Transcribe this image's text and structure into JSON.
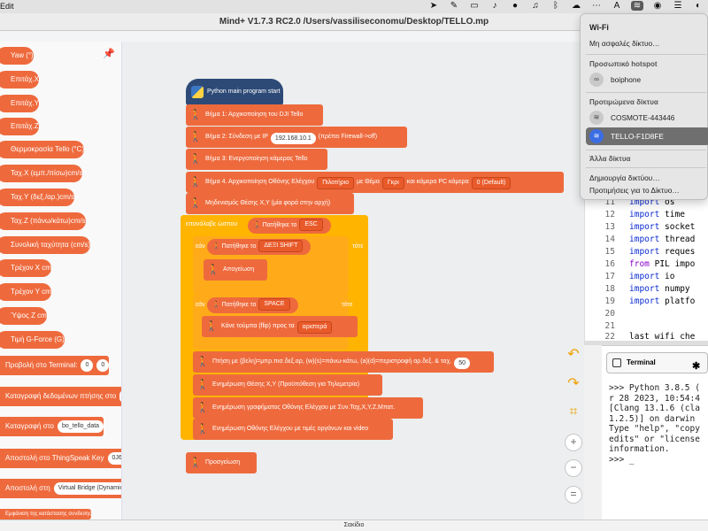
{
  "menubar": {
    "left_text": "Edit",
    "icons": [
      "location-icon",
      "pen-icon",
      "battery-icon",
      "volume-icon",
      "mic-icon",
      "music-icon",
      "bluetooth-icon",
      "bluetooth-alt-icon",
      "cloud-icon",
      "dots-icon",
      "text-input-icon",
      "wifi-icon",
      "user-icon",
      "settings-icon",
      "switch-icon",
      "siri-icon"
    ]
  },
  "window": {
    "title": "Mind+ V1.7.3 RC2.0  /Users/vassiliseconomu/Desktop/TELLO.mp"
  },
  "palette": {
    "blocks": [
      {
        "label": "Yaw (°)"
      },
      {
        "label": "Επιτάχ.X"
      },
      {
        "label": "Επιτάχ.Y"
      },
      {
        "label": "Επιτάχ.Z"
      },
      {
        "label": "Θερμοκρασία Tello (°C)"
      },
      {
        "label": "Ταχ.X (εμπ./πίσω)cm/s"
      },
      {
        "label": "Ταχ.Y (δεξ./αρ.)cm/s"
      },
      {
        "label": "Ταχ.Z (πάνω/κάτω)cm/s"
      },
      {
        "label": "Συνολική ταχύτητα (cm/s)"
      },
      {
        "label": "Τρέχον X cm"
      },
      {
        "label": "Τρέχον Y cm"
      },
      {
        "label": "Ύψος Z cm"
      },
      {
        "label": "Τιμή G-Force (G)"
      }
    ],
    "commands": [
      {
        "label": "Προβολή στο Terminal:",
        "inputs": [
          "0",
          "0"
        ]
      },
      {
        "label": "Καταγραφή δεδομένων πτήσης στο",
        "inputs": [
          ""
        ]
      },
      {
        "label": "Καταγραφή στο",
        "inputs": [
          "bo_tello_data"
        ]
      },
      {
        "label": "Αποστολή στο ThingSpeak Key",
        "inputs": [
          "0J62F"
        ]
      },
      {
        "label": "Αποστολή στη",
        "inputs": [
          "Virtual Bridge (Dynamic"
        ]
      },
      {
        "label": "Εμφάνιση της κατάστασης συνδεσης"
      }
    ]
  },
  "workspace": {
    "hat_label": "Python main program start",
    "steps": [
      "Βήμα 1: Αρχικοποίηση του DJI Tello",
      "Βήμα 2: Σύνδεση με IP",
      "Βήμα 3: Ενεργοποίηση κάμερας Tello",
      "Βήμα 4. Αρχικοποίηση Οθόνης Ελέγχου",
      "Μηδενισμός Θέσης X,Y (μία φορά στην αρχή)"
    ],
    "ip_value": "192.168.10.1",
    "ip_note": "(πρέπει Firewall->off)",
    "step4_mode": "Πιλοτήριο",
    "step4_theme_label": "με Θέμα",
    "step4_theme": "Γκρι",
    "step4_camera_label": "και κάμερα PC  κάμερα",
    "step4_camera": "0 (Default)",
    "loop_label": "επανάλαβε ώσπου",
    "pressed_label": "Πατήθηκε το",
    "key_esc": "ESC",
    "if_label": "εάν",
    "then_label": "τότε",
    "key_shift": "ΔΕΞΙ SHIFT",
    "land_label": "Απογείωση",
    "key_space": "SPACE",
    "flip_label": "Κάνε τούμπα (flip) προς τα",
    "flip_dir": "αριστερά",
    "fly_label": "Πτήση με (βελη)=μπρ.πισ.δεξ.αρ, (w)(s)=πάνω-κάτω, (a)(d)=περιστροφή αρ.δεξ. & ταχ.",
    "fly_speed": "50",
    "update1": "Ενημέρωση Θέσης X,Y (Προϋπόθεση για Τηλεμετρία)",
    "update2": "Ενημέρωση γραφήματος Οθόνης Ελέγχου με Συν.Ταχ,X,Y,Z,Μπατ.",
    "update3": "Ενημέρωση Οθόνης Ελέγχου με τιμές οργάνων και video",
    "landing": "Προσγείωση"
  },
  "code": {
    "lines": [
      {
        "num": "11",
        "kw": "import",
        "rest": " os"
      },
      {
        "num": "12",
        "kw": "import",
        "rest": " time"
      },
      {
        "num": "13",
        "kw": "import",
        "rest": " socket"
      },
      {
        "num": "14",
        "kw": "import",
        "rest": " thread"
      },
      {
        "num": "15",
        "kw": "import",
        "rest": " reques"
      },
      {
        "num": "16",
        "kw": "from",
        "rest": " PIL impo"
      },
      {
        "num": "17",
        "kw": "import",
        "rest": " io"
      },
      {
        "num": "18",
        "kw": "import",
        "rest": " numpy"
      },
      {
        "num": "19",
        "kw": "import",
        "rest": " platfo"
      },
      {
        "num": "20",
        "kw": "",
        "rest": ""
      },
      {
        "num": "21",
        "kw": "",
        "rest": ""
      },
      {
        "num": "22",
        "kw": "",
        "rest": "last_wifi_che"
      }
    ]
  },
  "terminal": {
    "title": "Terminal",
    "output": ">>> Python 3.8.5 (\nr 28 2023, 10:54:4\n[Clang 13.1.6 (cla\n1.2.5)] on darwin\nType \"help\", \"copy\nedits\" or \"license\ninformation.\n>>> _"
  },
  "wifi_menu": {
    "title": "Wi-Fi",
    "insecure": "Μη ασφαλές δίκτυο…",
    "hotspot_heading": "Προσωπικό hotspot",
    "hotspot": "boiphone",
    "preferred_heading": "Προτιμώμενα δίκτυα",
    "networks": [
      "COSMOTE-443446",
      "TELLO-F1D8FE"
    ],
    "other_heading": "Άλλα δίκτυα",
    "create": "Δημιουργία δικτύου…",
    "prefs": "Προτιμήσεις για το Δίκτυο…"
  },
  "status": {
    "label": "Σακίδιο"
  }
}
